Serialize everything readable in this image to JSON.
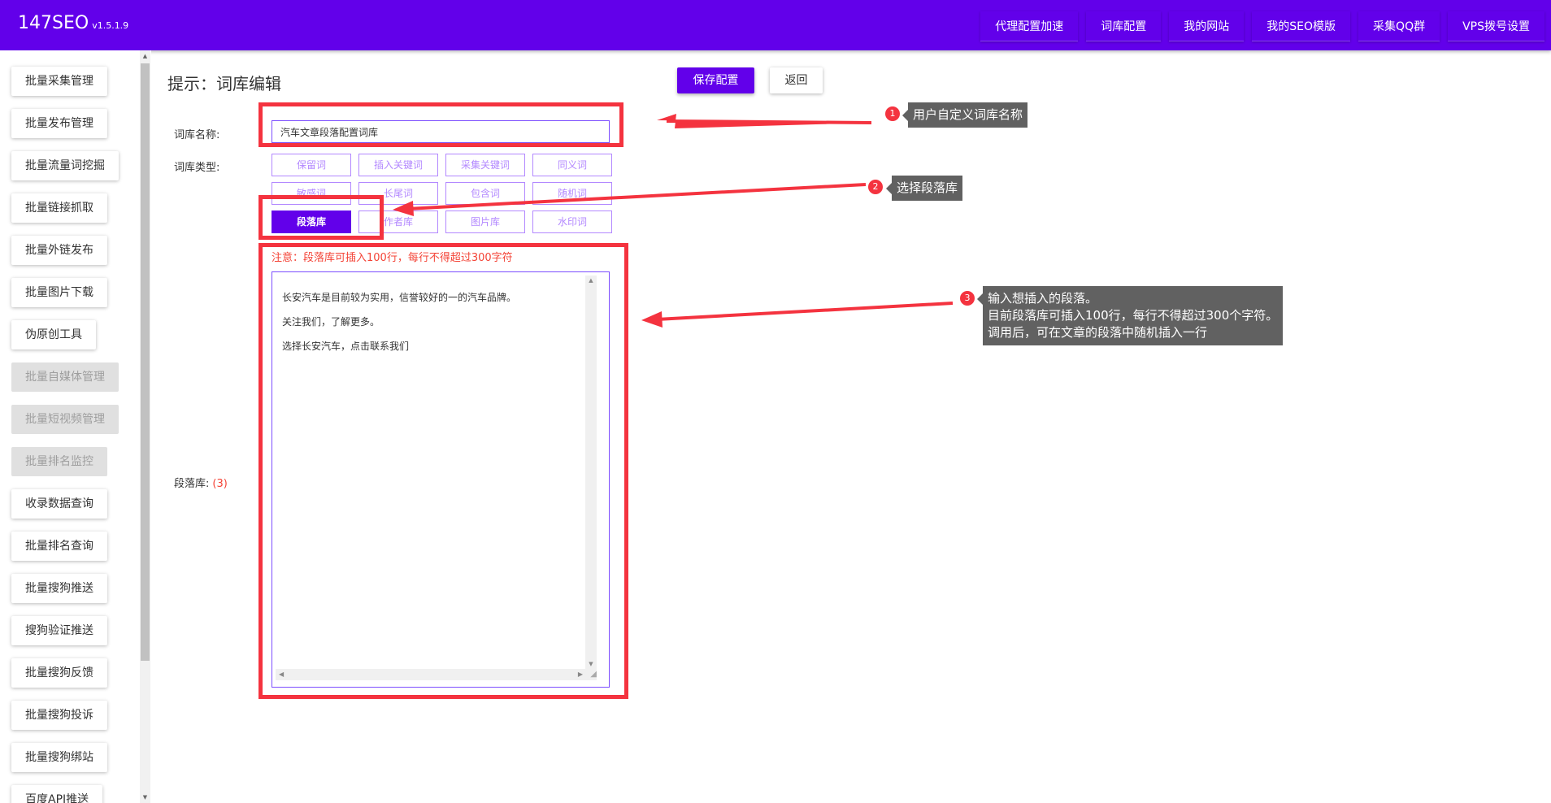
{
  "app": {
    "brand": "147SEO",
    "version": "v1.5.1.9"
  },
  "topnav": [
    "代理配置加速",
    "词库配置",
    "我的网站",
    "我的SEO模版",
    "采集QQ群",
    "VPS拨号设置"
  ],
  "sidebar": {
    "items": [
      {
        "label": "批量采集管理",
        "disabled": false
      },
      {
        "label": "批量发布管理",
        "disabled": false
      },
      {
        "label": "批量流量词挖掘",
        "disabled": false
      },
      {
        "label": "批量链接抓取",
        "disabled": false
      },
      {
        "label": "批量外链发布",
        "disabled": false
      },
      {
        "label": "批量图片下载",
        "disabled": false
      },
      {
        "label": "伪原创工具",
        "disabled": false
      },
      {
        "label": "批量自媒体管理",
        "disabled": true
      },
      {
        "label": "批量短视频管理",
        "disabled": true
      },
      {
        "label": "批量排名监控",
        "disabled": true
      },
      {
        "label": "收录数据查询",
        "disabled": false
      },
      {
        "label": "批量排名查询",
        "disabled": false
      },
      {
        "label": "批量搜狗推送",
        "disabled": false
      },
      {
        "label": "搜狗验证推送",
        "disabled": false
      },
      {
        "label": "批量搜狗反馈",
        "disabled": false
      },
      {
        "label": "批量搜狗投诉",
        "disabled": false
      },
      {
        "label": "批量搜狗绑站",
        "disabled": false
      },
      {
        "label": "百度API推送",
        "disabled": false
      }
    ]
  },
  "main": {
    "title": "提示：词库编辑",
    "save_label": "保存配置",
    "back_label": "返回",
    "name_label": "词库名称:",
    "name_value": "汽车文章段落配置词库",
    "type_label": "词库类型:",
    "types": [
      "保留词",
      "插入关键词",
      "采集关键词",
      "同义词",
      "敏感词",
      "长尾词",
      "包含词",
      "随机词",
      "段落库",
      "作者库",
      "图片库",
      "水印词"
    ],
    "active_type": "段落库",
    "note": "注意：段落库可插入100行，每行不得超过300字符",
    "para_label": "段落库:",
    "para_count": "(3)",
    "para_lines": [
      "长安汽车是目前较为实用，信誉较好的一的汽车品牌。",
      "关注我们，了解更多。",
      "选择长安汽车，点击联系我们"
    ]
  },
  "annotations": {
    "n1": "1",
    "tip1": "用户自定义词库名称",
    "n2": "2",
    "tip2": "选择段落库",
    "n3": "3",
    "tip3_lines": [
      "输入想插入的段落。",
      "目前段落库可插入100行，每行不得超过300个字符。",
      "调用后，可在文章的段落中随机插入一行"
    ]
  },
  "colors": {
    "primary": "#6200ea",
    "accent_light": "#b388ff",
    "annotation_red": "#f4333f",
    "tooltip_bg": "#616161"
  }
}
